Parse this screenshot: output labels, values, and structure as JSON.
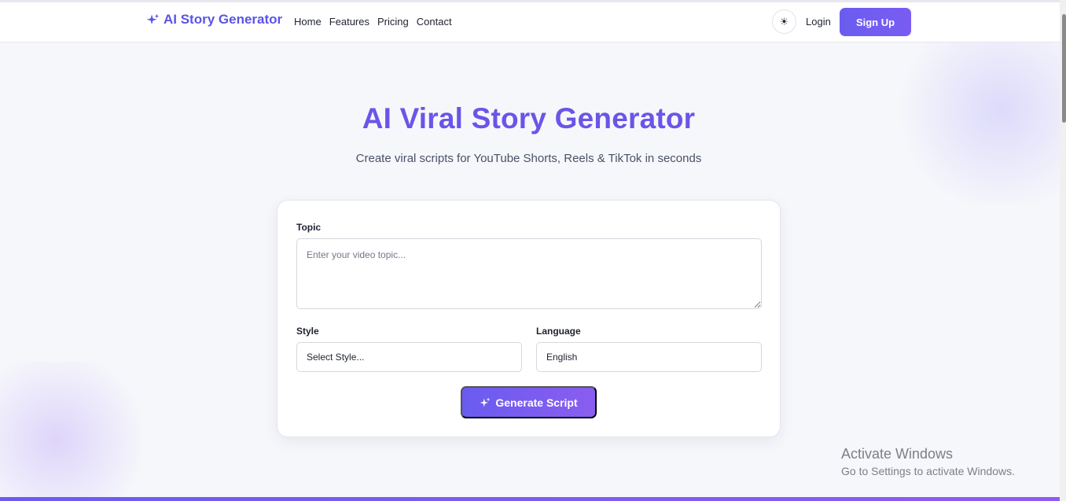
{
  "nav": {
    "brand": "AI Story Generator",
    "links": [
      "Home",
      "Features",
      "Pricing",
      "Contact"
    ],
    "login": "Login",
    "signup": "Sign Up"
  },
  "hero": {
    "title": "AI Viral Story Generator",
    "subtitle": "Create viral scripts for YouTube Shorts, Reels & TikTok in seconds"
  },
  "form": {
    "topic_label": "Topic",
    "topic_placeholder": "Enter your video topic...",
    "style_label": "Style",
    "style_value": "Select Style...",
    "language_label": "Language",
    "language_value": "English",
    "generate_label": "Generate Script"
  },
  "watermark": {
    "title": "Activate Windows",
    "subtitle": "Go to Settings to activate Windows."
  },
  "icons": {
    "brand": "sparkles-icon",
    "theme": "sun-icon",
    "generate": "sparkles-icon"
  },
  "colors": {
    "accent": "#6a5cf0",
    "title": "#6a55e8"
  }
}
